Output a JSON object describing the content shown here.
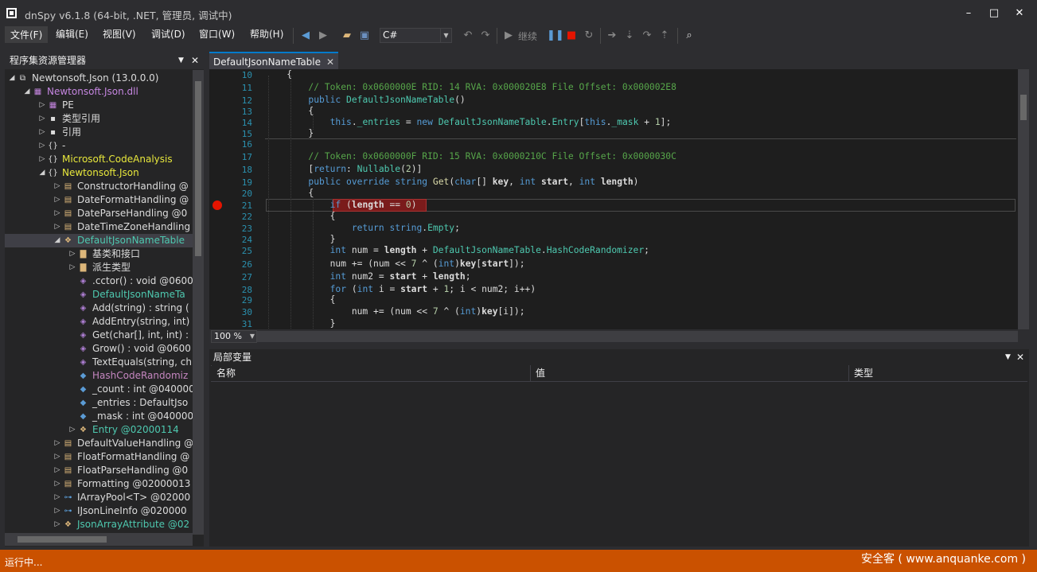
{
  "window": {
    "title": "dnSpy v6.1.8 (64-bit, .NET, 管理员, 调试中)",
    "minimize": "–",
    "maximize": "□",
    "close": "✕"
  },
  "menu": [
    "文件(F)",
    "编辑(E)",
    "视图(V)",
    "调试(D)",
    "窗口(W)",
    "帮助(H)"
  ],
  "toolbar": {
    "language": "C#",
    "continue_label": "继续"
  },
  "explorer": {
    "title": "程序集资源管理器",
    "dropdown": "▼",
    "close": "✕",
    "items": [
      {
        "exp": "◢",
        "icon": "assembly-icon",
        "label": "Newtonsoft.Json (13.0.0.0)",
        "color": "#dcdcdc"
      },
      {
        "exp": "◢",
        "icon": "dll-icon",
        "label": "Newtonsoft.Json.dll",
        "color": "#c586e0"
      },
      {
        "exp": "▷",
        "icon": "pe-icon",
        "label": "PE",
        "color": "#dcdcdc"
      },
      {
        "exp": "▷",
        "icon": "type-ref-icon",
        "label": "类型引用",
        "color": "#dcdcdc"
      },
      {
        "exp": "▷",
        "icon": "reference-icon",
        "label": "引用",
        "color": "#dcdcdc"
      },
      {
        "exp": "▷",
        "icon": "namespace-icon",
        "label": "-",
        "color": "#dcdcdc"
      },
      {
        "exp": "▷",
        "icon": "namespace-icon",
        "label": "Microsoft.CodeAnalysis",
        "color": "#e8e83c"
      },
      {
        "exp": "◢",
        "icon": "namespace-icon",
        "label": "Newtonsoft.Json",
        "color": "#e8e83c"
      },
      {
        "exp": "▷",
        "icon": "enum-icon",
        "label": "ConstructorHandling @",
        "color": "#dcdcdc"
      },
      {
        "exp": "▷",
        "icon": "enum-icon",
        "label": "DateFormatHandling @",
        "color": "#dcdcdc"
      },
      {
        "exp": "▷",
        "icon": "enum-icon",
        "label": "DateParseHandling @0",
        "color": "#dcdcdc"
      },
      {
        "exp": "▷",
        "icon": "enum-icon",
        "label": "DateTimeZoneHandling",
        "color": "#dcdcdc"
      },
      {
        "exp": "◢",
        "icon": "class-icon",
        "label": "DefaultJsonNameTable",
        "color": "#4ec9b0"
      },
      {
        "exp": "▷",
        "icon": "folder-icon",
        "label": "基类和接口",
        "color": "#dcdcdc"
      },
      {
        "exp": "▷",
        "icon": "folder-icon",
        "label": "派生类型",
        "color": "#dcdcdc"
      },
      {
        "exp": "",
        "icon": "method-icon",
        "label": ".cctor() : void @0600",
        "color": "#dcdcdc"
      },
      {
        "exp": "",
        "icon": "method-icon",
        "label": "DefaultJsonNameTa",
        "color": "#4ec9b0"
      },
      {
        "exp": "",
        "icon": "method-icon",
        "label": "Add(string) : string (",
        "color": "#dcdcdc"
      },
      {
        "exp": "",
        "icon": "method-icon",
        "label": "AddEntry(string, int)",
        "color": "#dcdcdc"
      },
      {
        "exp": "",
        "icon": "method-icon",
        "label": "Get(char[], int, int) :",
        "color": "#dcdcdc"
      },
      {
        "exp": "",
        "icon": "method-icon",
        "label": "Grow() : void @0600",
        "color": "#dcdcdc"
      },
      {
        "exp": "",
        "icon": "method-icon",
        "label": "TextEquals(string, ch",
        "color": "#dcdcdc"
      },
      {
        "exp": "",
        "icon": "field-icon",
        "label": "HashCodeRandomiz",
        "color": "#c586c0"
      },
      {
        "exp": "",
        "icon": "field-icon",
        "label": "_count : int @040000",
        "color": "#dcdcdc"
      },
      {
        "exp": "",
        "icon": "field-icon",
        "label": "_entries : DefaultJso",
        "color": "#dcdcdc"
      },
      {
        "exp": "",
        "icon": "field-icon",
        "label": "_mask : int @040000",
        "color": "#dcdcdc"
      },
      {
        "exp": "▷",
        "icon": "nested-class-icon",
        "label": "Entry @02000114",
        "color": "#4ec9b0"
      },
      {
        "exp": "▷",
        "icon": "enum-icon",
        "label": "DefaultValueHandling @",
        "color": "#dcdcdc"
      },
      {
        "exp": "▷",
        "icon": "enum-icon",
        "label": "FloatFormatHandling @",
        "color": "#dcdcdc"
      },
      {
        "exp": "▷",
        "icon": "enum-icon",
        "label": "FloatParseHandling @0",
        "color": "#dcdcdc"
      },
      {
        "exp": "▷",
        "icon": "enum-icon",
        "label": "Formatting @02000013",
        "color": "#dcdcdc"
      },
      {
        "exp": "▷",
        "icon": "interface-icon",
        "label": "IArrayPool<T> @02000",
        "color": "#dcdcdc"
      },
      {
        "exp": "▷",
        "icon": "interface-icon",
        "label": "IJsonLineInfo @020000",
        "color": "#dcdcdc"
      },
      {
        "exp": "▷",
        "icon": "class-icon",
        "label": "JsonArrayAttribute @02",
        "color": "#4ec9b0"
      }
    ]
  },
  "editor": {
    "tab_label": "DefaultJsonNameTable",
    "tab_close": "✕",
    "zoom": "100 %",
    "line_numbers": [
      "10",
      "11",
      "12",
      "13",
      "14",
      "15",
      "16",
      "17",
      "18",
      "19",
      "20",
      "21",
      "22",
      "23",
      "24",
      "25",
      "26",
      "27",
      "28",
      "29",
      "30",
      "31"
    ],
    "code": [
      "    {",
      "        // Token: 0x0600000E RID: 14 RVA: 0x000020E8 File Offset: 0x000002E8",
      "        public DefaultJsonNameTable()",
      "        {",
      "            this._entries = new DefaultJsonNameTable.Entry[this._mask + 1];",
      "        }",
      "",
      "        // Token: 0x0600000F RID: 15 RVA: 0x0000210C File Offset: 0x0000030C",
      "        [return: Nullable(2)]",
      "        public override string Get(char[] key, int start, int length)",
      "        {",
      "            if (length == 0)",
      "            {",
      "                return string.Empty;",
      "            }",
      "            int num = length + DefaultJsonNameTable.HashCodeRandomizer;",
      "            num += (num << 7 ^ (int)key[start]);",
      "            int num2 = start + length;",
      "            for (int i = start + 1; i < num2; i++)",
      "            {",
      "                num += (num << 7 ^ (int)key[i]);",
      "            }"
    ]
  },
  "locals": {
    "title": "局部变量",
    "dropdown": "▼",
    "close": "✕",
    "columns": [
      "名称",
      "值",
      "类型"
    ]
  },
  "status": {
    "text": "运行中...",
    "watermark": "安全客 ( www.anquanke.com )"
  },
  "colors": {
    "accent": "#007acc",
    "statusbar": "#ca5100",
    "breakpoint": "#e51400"
  }
}
